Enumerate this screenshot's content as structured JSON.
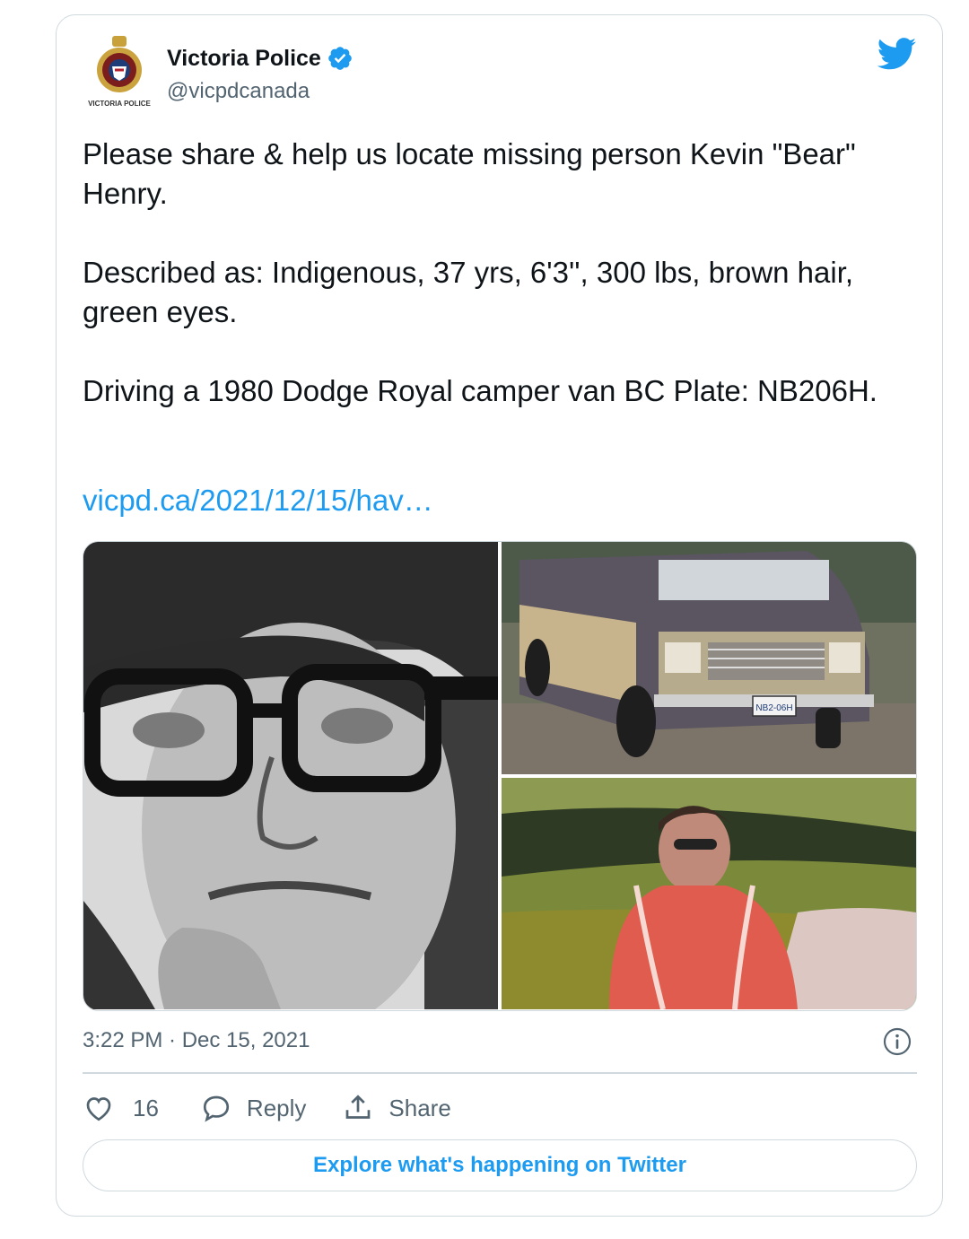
{
  "tweet": {
    "author_name": "Victoria Police",
    "author_handle": "@vicpdcanada",
    "avatar_badge_text": "VICTORIA POLICE",
    "text": "Please share & help us locate missing person Kevin \"Bear\" Henry.\n\nDescribed as: Indigenous, 37 yrs, 6'3'', 300 lbs, brown hair, green eyes.\n\nDriving a 1980 Dodge Royal camper van BC Plate: NB206H.",
    "link": "vicpd.ca/2021/12/15/hav…",
    "timestamp": "3:22 PM · Dec 15, 2021",
    "like_count": "16",
    "reply_label": "Reply",
    "share_label": "Share",
    "explore_label": "Explore what's happening on Twitter",
    "plate_text": "NB2-06H"
  },
  "icons": {
    "verified": "verified-badge-icon",
    "brand": "twitter-bird-icon",
    "info": "info-icon",
    "like": "heart-icon",
    "reply": "reply-bubble-icon",
    "share": "share-upload-icon"
  },
  "colors": {
    "accent": "#1d9bf0",
    "text": "#0f1419",
    "secondary": "#536471",
    "border": "#cfd9de"
  }
}
